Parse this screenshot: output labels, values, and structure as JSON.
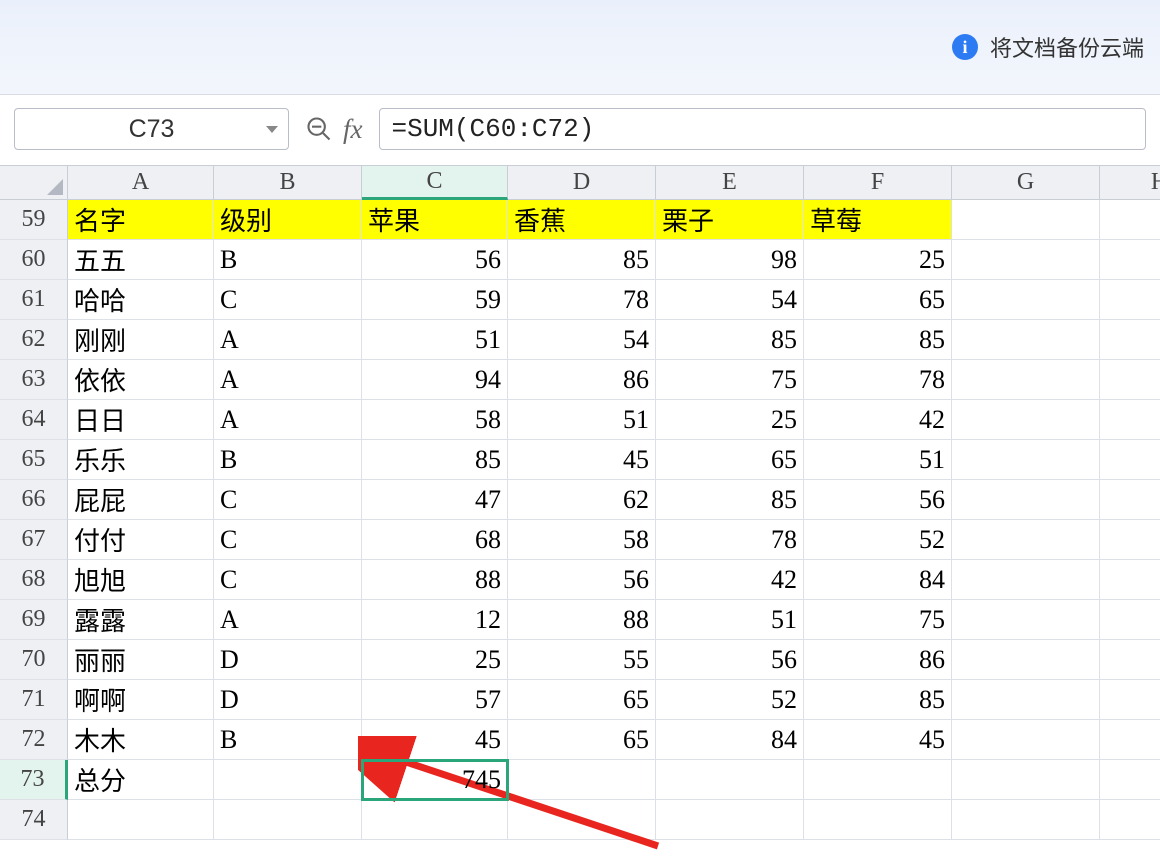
{
  "banner": {
    "text": "将文档备份云端"
  },
  "name_box": "C73",
  "fx_label": "fx",
  "formula": "=SUM(C60:C72)",
  "columns": [
    "A",
    "B",
    "C",
    "D",
    "E",
    "F",
    "G",
    "H"
  ],
  "active_column": "C",
  "row_start": 59,
  "row_end": 74,
  "active_row": 73,
  "headers": [
    "名字",
    "级别",
    "苹果",
    "香蕉",
    "栗子",
    "草莓"
  ],
  "rows": [
    {
      "n": 60,
      "a": "五五",
      "b": "B",
      "c": 56,
      "d": 85,
      "e": 98,
      "f": 25
    },
    {
      "n": 61,
      "a": "哈哈",
      "b": "C",
      "c": 59,
      "d": 78,
      "e": 54,
      "f": 65
    },
    {
      "n": 62,
      "a": "刚刚",
      "b": "A",
      "c": 51,
      "d": 54,
      "e": 85,
      "f": 85
    },
    {
      "n": 63,
      "a": "依依",
      "b": "A",
      "c": 94,
      "d": 86,
      "e": 75,
      "f": 78
    },
    {
      "n": 64,
      "a": "日日",
      "b": "A",
      "c": 58,
      "d": 51,
      "e": 25,
      "f": 42
    },
    {
      "n": 65,
      "a": "乐乐",
      "b": "B",
      "c": 85,
      "d": 45,
      "e": 65,
      "f": 51
    },
    {
      "n": 66,
      "a": "屁屁",
      "b": "C",
      "c": 47,
      "d": 62,
      "e": 85,
      "f": 56
    },
    {
      "n": 67,
      "a": "付付",
      "b": "C",
      "c": 68,
      "d": 58,
      "e": 78,
      "f": 52
    },
    {
      "n": 68,
      "a": "旭旭",
      "b": "C",
      "c": 88,
      "d": 56,
      "e": 42,
      "f": 84
    },
    {
      "n": 69,
      "a": "露露",
      "b": "A",
      "c": 12,
      "d": 88,
      "e": 51,
      "f": 75
    },
    {
      "n": 70,
      "a": "丽丽",
      "b": "D",
      "c": 25,
      "d": 55,
      "e": 56,
      "f": 86
    },
    {
      "n": 71,
      "a": "啊啊",
      "b": "D",
      "c": 57,
      "d": 65,
      "e": 52,
      "f": 85
    },
    {
      "n": 72,
      "a": "木木",
      "b": "B",
      "c": 45,
      "d": 65,
      "e": 84,
      "f": 45
    }
  ],
  "total_row": {
    "n": 73,
    "label": "总分",
    "c": 745
  }
}
